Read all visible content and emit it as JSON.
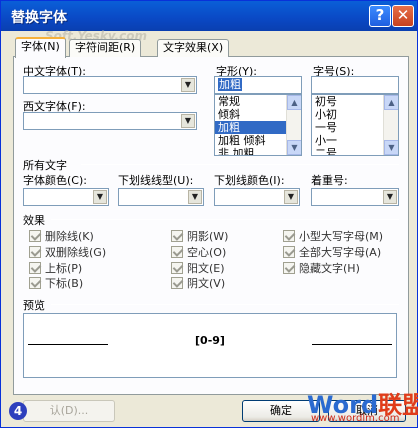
{
  "window": {
    "title": "替换字体",
    "help_glyph": "?",
    "close_glyph": "✕",
    "watermark": "Soft.Yesky.com"
  },
  "tabs": [
    {
      "label": "字体(N)"
    },
    {
      "label": "字符间距(R)"
    },
    {
      "label": "文字效果(X)"
    }
  ],
  "font": {
    "chinese_font_label": "中文字体(T):",
    "chinese_font_value": "",
    "western_font_label": "西文字体(F):",
    "western_font_value": "",
    "style_label": "字形(Y):",
    "style_value": "加粗",
    "style_options": [
      "常规",
      "倾斜",
      "加粗",
      "加粗 倾斜",
      "非 加粗"
    ],
    "style_selected_index": 2,
    "size_label": "字号(S):",
    "size_value": "",
    "size_options": [
      "初号",
      "小初",
      "一号",
      "小一",
      "二号"
    ]
  },
  "all_text": {
    "section_label": "所有文字",
    "font_color_label": "字体颜色(C):",
    "underline_type_label": "下划线线型(U):",
    "underline_color_label": "下划线颜色(I):",
    "emphasis_label": "着重号:"
  },
  "effects": {
    "section_label": "效果",
    "items": [
      {
        "label": "删除线(K)"
      },
      {
        "label": "双删除线(G)"
      },
      {
        "label": "上标(P)"
      },
      {
        "label": "下标(B)"
      },
      {
        "label": "阴影(W)"
      },
      {
        "label": "空心(O)"
      },
      {
        "label": "阳文(E)"
      },
      {
        "label": "阴文(V)"
      },
      {
        "label": "小型大写字母(M)"
      },
      {
        "label": "全部大写字母(A)"
      },
      {
        "label": "隐藏文字(H)"
      }
    ]
  },
  "preview": {
    "section_label": "预览",
    "sample_text": "[0-9]"
  },
  "buttons": {
    "default_label": "认(D)...",
    "ok_label": "确定",
    "cancel_label": "取消"
  },
  "overlay": {
    "badge_number": "4",
    "logo_word": "Word",
    "logo_cn": "联盟",
    "logo_url": "www.wordlm.com"
  },
  "colors": {
    "titlebar": "#0a5fd8",
    "dialog_bg": "#ece9d8",
    "selection": "#316ac5",
    "tab_accent": "#f6b13a"
  }
}
